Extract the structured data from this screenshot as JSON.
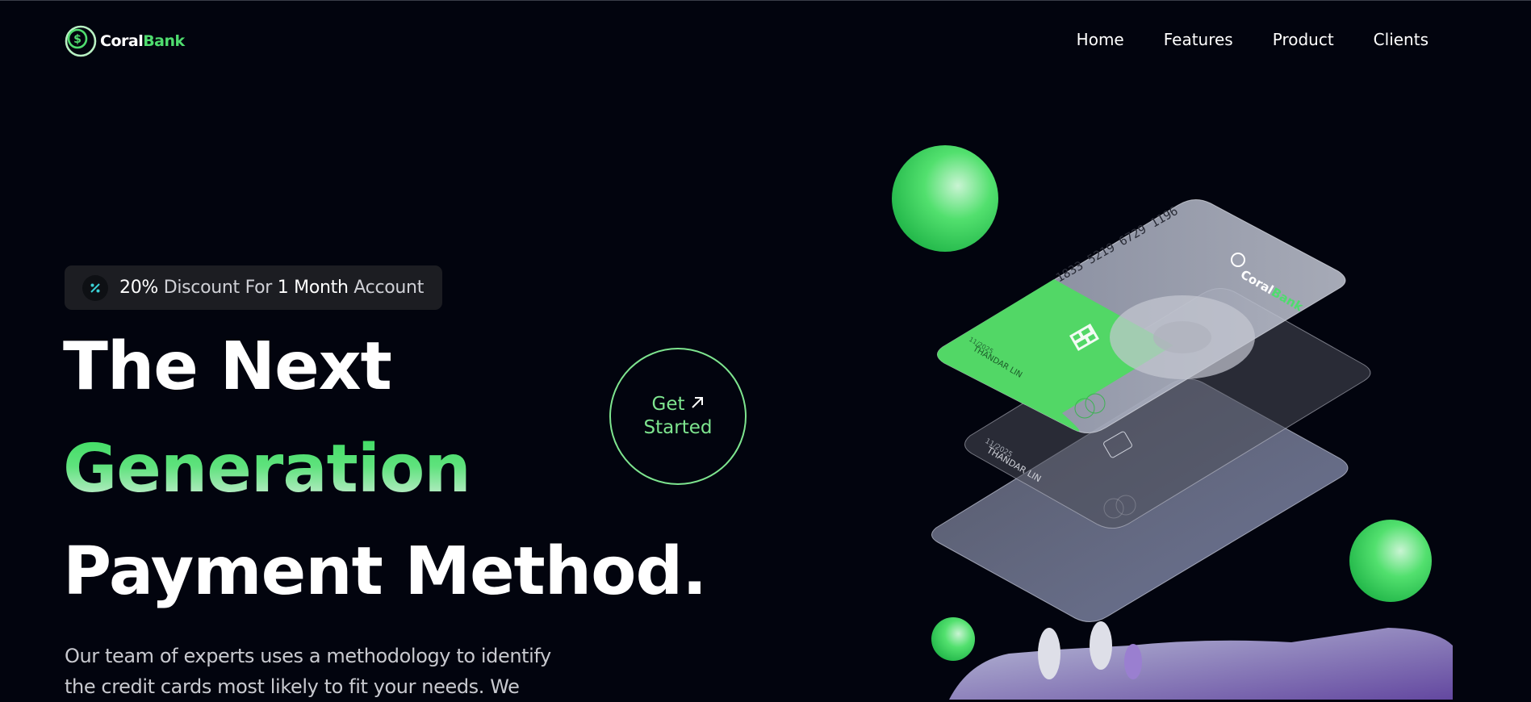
{
  "brand": {
    "name_part1": "Coral",
    "name_part2": "Bank",
    "icon": "dollar-coin-icon"
  },
  "nav": {
    "items": [
      "Home",
      "Features",
      "Product",
      "Clients"
    ]
  },
  "badge": {
    "icon": "percent-icon",
    "percent": "20%",
    "mid": " Discount For ",
    "month": "1 Month",
    "end": " Account"
  },
  "hero": {
    "line1": "The Next",
    "line2": "Generation",
    "line3": "Payment Method.",
    "description": "Our team of experts uses a methodology to identify the credit cards most likely to fit your needs. We"
  },
  "cta": {
    "line1": "Get",
    "line2": "Started",
    "icon": "arrow-up-right-icon"
  },
  "card": {
    "number": "1833 5219 6729 1196",
    "holder": "THANDAR LIN",
    "expiry": "11/2025",
    "brand_part1": "Coral",
    "brand_part2": "Bank"
  },
  "colors": {
    "accent": "#4fdc6e",
    "background": "#02040e",
    "badge_bg": "#1c1d22"
  }
}
